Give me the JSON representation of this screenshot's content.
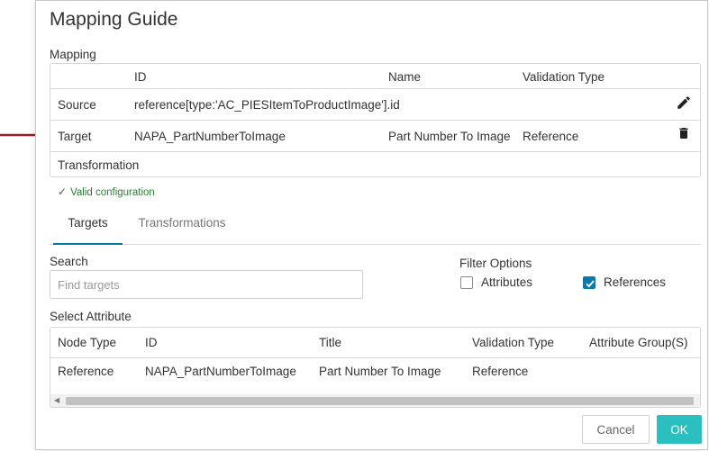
{
  "dialog": {
    "title": "Mapping Guide"
  },
  "mapping": {
    "section_label": "Mapping",
    "headers": {
      "id": "ID",
      "name": "Name",
      "validation_type": "Validation Type"
    },
    "rows": [
      {
        "label": "Source",
        "id": "reference[type:'AC_PIESItemToProductImage'].id",
        "name": "",
        "validation_type": "",
        "action_icon": "pencil-icon"
      },
      {
        "label": "Target",
        "id": "NAPA_PartNumberToImage",
        "name": "Part Number To Image",
        "validation_type": "Reference",
        "action_icon": "trash-icon"
      },
      {
        "label": "Transformation",
        "id": "",
        "name": "",
        "validation_type": ""
      }
    ],
    "status": "Valid configuration"
  },
  "tabs": [
    {
      "label": "Targets",
      "active": true
    },
    {
      "label": "Transformations",
      "active": false
    }
  ],
  "search": {
    "label": "Search",
    "placeholder": "Find targets",
    "value": ""
  },
  "filter": {
    "label": "Filter Options",
    "options": [
      {
        "label": "Attributes",
        "checked": false
      },
      {
        "label": "References",
        "checked": true
      }
    ]
  },
  "select_attribute": {
    "label": "Select Attribute",
    "headers": [
      "Node Type",
      "ID",
      "Title",
      "Validation Type",
      "Attribute Group(S)"
    ],
    "rows": [
      [
        "Reference",
        "NAPA_PartNumberToImage",
        "Part Number To Image",
        "Reference",
        ""
      ]
    ]
  },
  "buttons": {
    "cancel": "Cancel",
    "ok": "OK"
  },
  "colors": {
    "accent": "#0a7aa8",
    "ok_button": "#2bbfc0",
    "valid": "#2e7d32",
    "arrow": "#9b1c24"
  }
}
